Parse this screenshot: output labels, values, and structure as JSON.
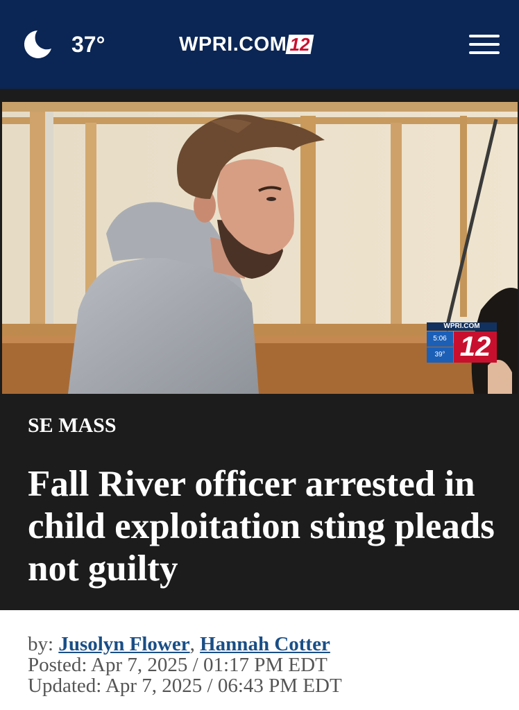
{
  "header": {
    "weather_icon": "moon-icon",
    "temperature": "37°",
    "brand_text": "WPRI.COM",
    "brand_badge": "12",
    "menu_icon": "hamburger-menu-icon",
    "background": "#0b2654"
  },
  "photo": {
    "bug_site": "WPRI.COM",
    "bug_time": "5:06",
    "bug_temp": "39°",
    "bug_channel": "12"
  },
  "article": {
    "category": "SE MASS",
    "headline": "Fall River officer arrested in child exploitation sting pleads not guilty",
    "by_label": "by: ",
    "authors": [
      "Jusolyn Flower",
      "Hannah Cotter"
    ],
    "author_separator": ", ",
    "posted": "Posted: Apr 7, 2025 / 01:17 PM EDT",
    "updated": "Updated: Apr 7, 2025 / 06:43 PM EDT"
  },
  "colors": {
    "nav": "#0b2654",
    "dark_band": "#1c1c1c",
    "link": "#1a4e86",
    "brand_red": "#c8102e"
  }
}
